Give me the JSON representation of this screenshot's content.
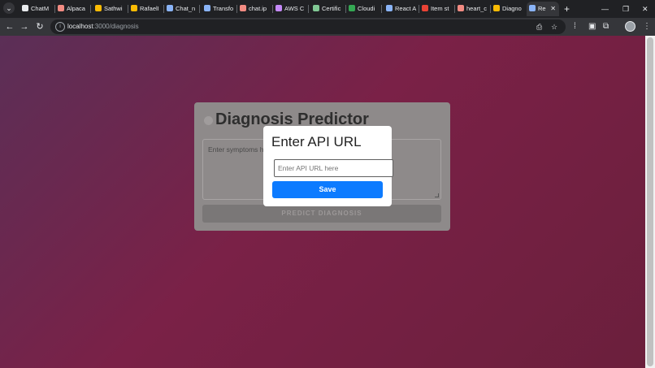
{
  "browser": {
    "tabs": [
      {
        "label": "ChatM",
        "color": "#e8eaed"
      },
      {
        "label": "Alpaca",
        "color": "#f28b82"
      },
      {
        "label": "Sathwi",
        "color": "#fbbc04"
      },
      {
        "label": "RafaelI",
        "color": "#fbbc04"
      },
      {
        "label": "Chat_n",
        "color": "#8ab4f8"
      },
      {
        "label": "Transfo",
        "color": "#8ab4f8"
      },
      {
        "label": "chat.ip",
        "color": "#f28b82"
      },
      {
        "label": "AWS C",
        "color": "#c58af9"
      },
      {
        "label": "Certific",
        "color": "#81c995"
      },
      {
        "label": "Cloudi",
        "color": "#34a853"
      },
      {
        "label": "React A",
        "color": "#8ab4f8"
      },
      {
        "label": "Item st",
        "color": "#ea4335"
      },
      {
        "label": "heart_c",
        "color": "#f28b82"
      },
      {
        "label": "Diagno",
        "color": "#fbbc04"
      },
      {
        "label": "Re",
        "color": "#8ab4f8"
      }
    ],
    "close_glyph": "✕",
    "new_tab_glyph": "+",
    "url_host": "localhost",
    "url_path": ":3000/diagnosis",
    "window_controls": {
      "minimize": "—",
      "restore": "❐",
      "close": "✕"
    }
  },
  "page": {
    "title": "Diagnosis Predictor",
    "symptoms_placeholder": "Enter symptoms h",
    "predict_button": "PREDICT DIAGNOSIS"
  },
  "modal": {
    "title": "Enter API URL",
    "input_placeholder": "Enter API URL here",
    "save_button": "Save"
  },
  "colors": {
    "accent": "#0d7bff",
    "background_gradient": [
      "#5b2f57",
      "#7a2147",
      "#6b1f3c"
    ]
  }
}
